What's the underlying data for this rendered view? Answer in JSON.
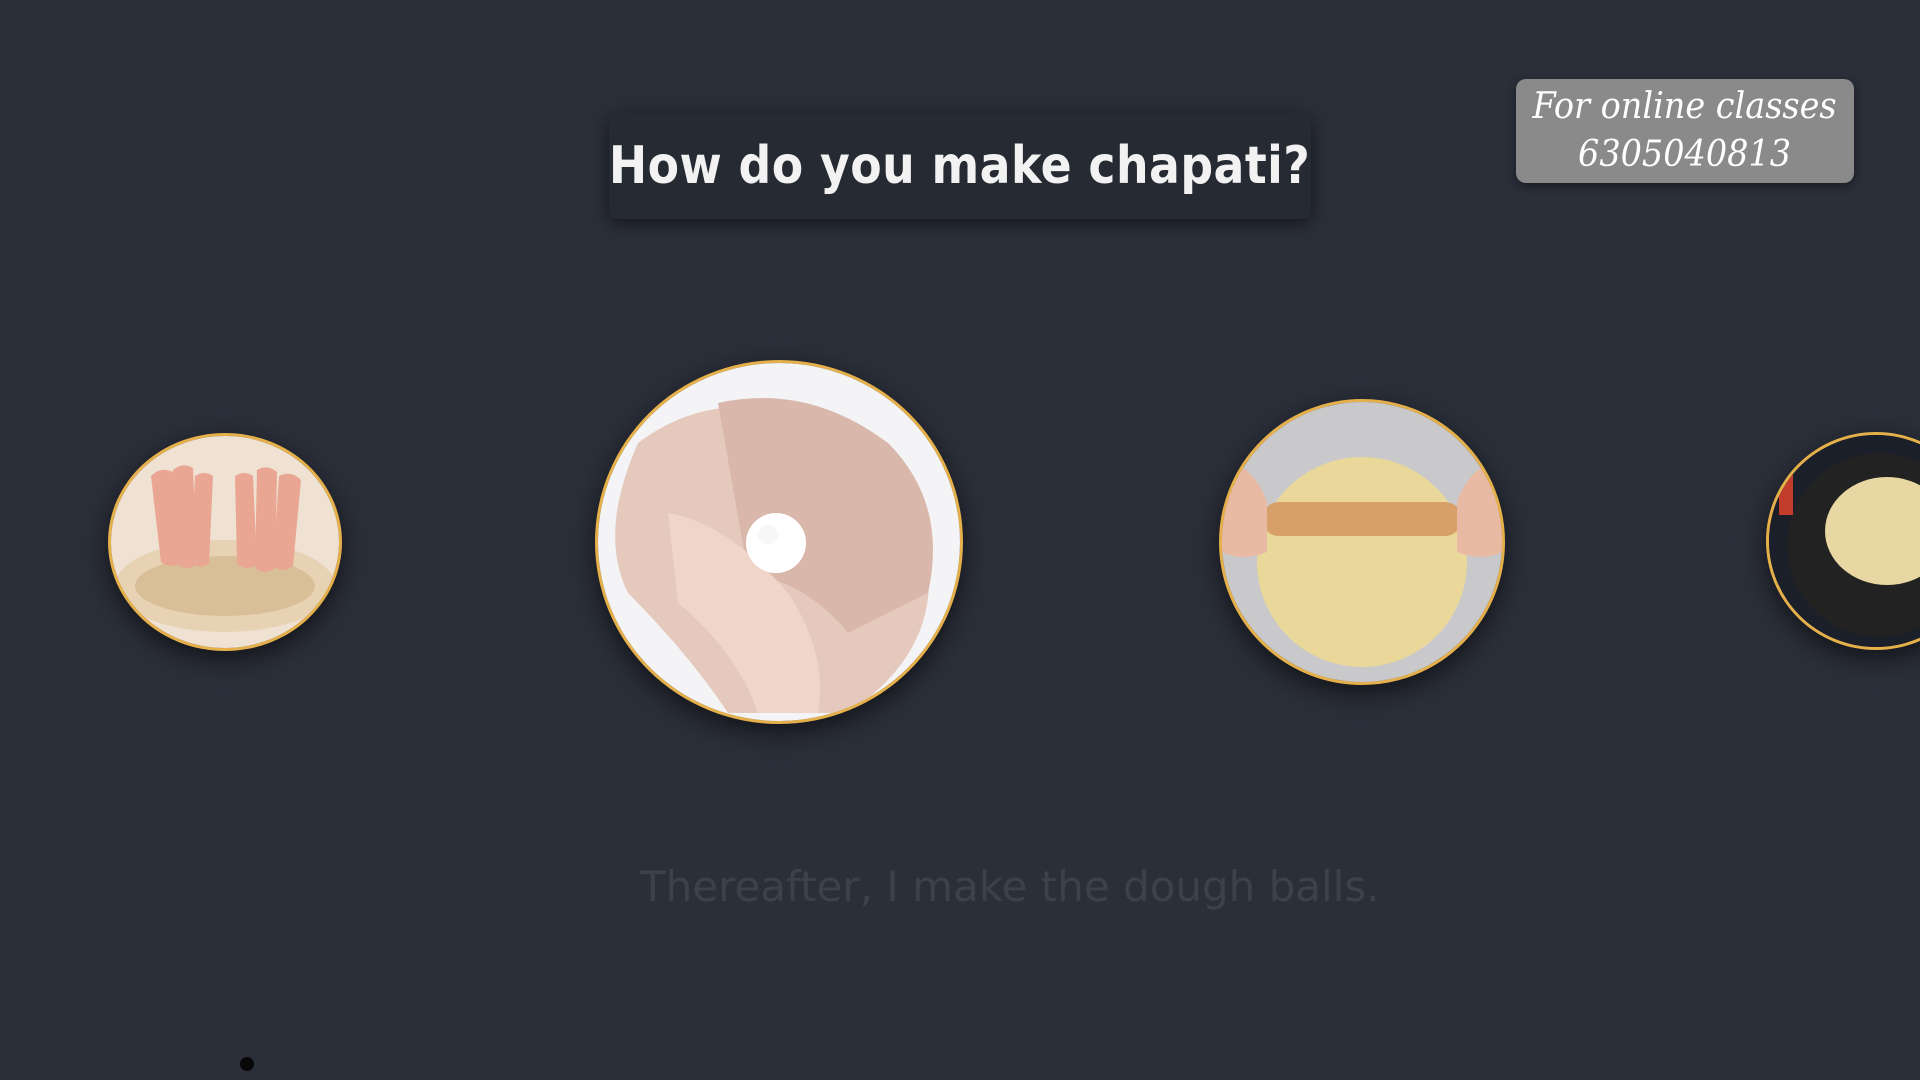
{
  "title": "How do you make chapati?",
  "promo": {
    "line1": "For online classes",
    "line2": "6305040813"
  },
  "steps": [
    {
      "icon": "kneading-dough-icon"
    },
    {
      "icon": "dough-ball-icon"
    },
    {
      "icon": "rolling-pin-icon"
    },
    {
      "icon": "chapati-pan-icon"
    }
  ],
  "caption": "Thereafter, I make the dough balls.",
  "colors": {
    "background": "#2b2f3a",
    "title_box": "#262a33",
    "promo_box": "#8a8a8a",
    "circle_border": "#e5b04a"
  }
}
